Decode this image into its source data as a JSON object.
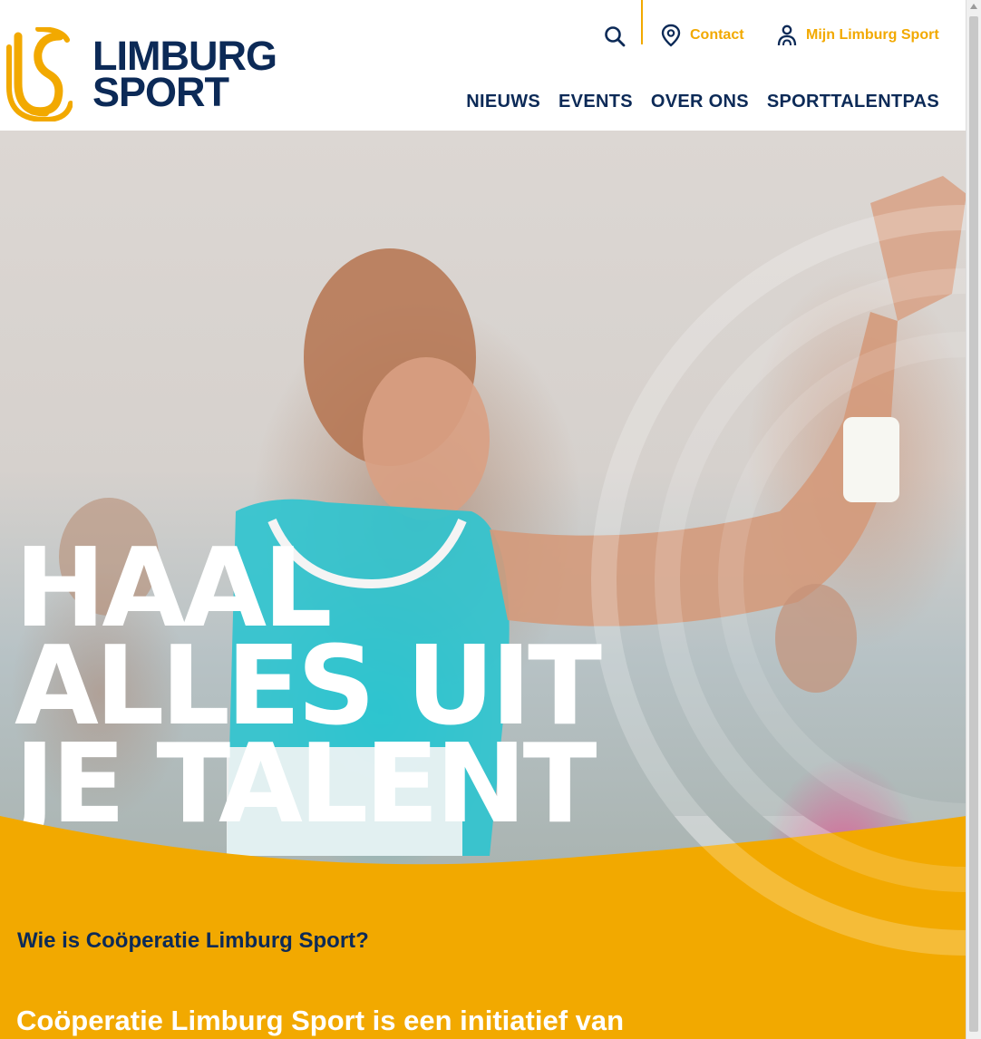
{
  "brand": {
    "line1": "LIMBURG",
    "line2": "SPORT",
    "accent_color": "#f2a900",
    "navy_color": "#0c2a57"
  },
  "utility": {
    "search_icon": "search-icon",
    "contact_label": "Contact",
    "contact_icon": "location-pin-icon",
    "account_label": "Mijn Limburg Sport",
    "account_icon": "user-icon"
  },
  "nav": {
    "items": [
      {
        "label": "NIEUWS"
      },
      {
        "label": "EVENTS"
      },
      {
        "label": "OVER ONS"
      },
      {
        "label": "SPORTTALENTPAS"
      }
    ]
  },
  "hero": {
    "line1": "HAAL",
    "line2": "ALLES UIT",
    "line3": "JE TALENT"
  },
  "about": {
    "question": "Wie is Coöperatie Limburg Sport?",
    "intro": "Coöperatie Limburg Sport is een initiatief van"
  }
}
